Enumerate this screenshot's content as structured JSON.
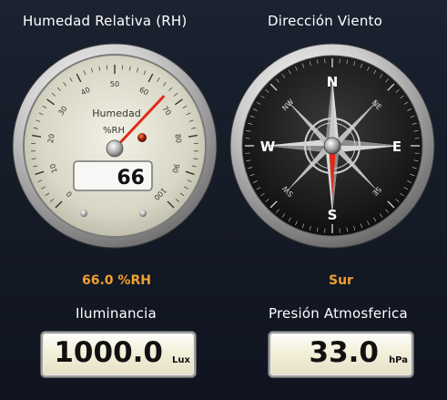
{
  "panels": {
    "humidity": {
      "title": "Humedad Relativa (RH)",
      "gauge_label_1": "Humedad",
      "gauge_label_2": "%RH",
      "display_value": "66",
      "reading": "66.0 %RH",
      "value": 66,
      "scale_min": 0,
      "scale_max": 100,
      "ticks": [
        "0",
        "10",
        "20",
        "30",
        "40",
        "50",
        "60",
        "70",
        "80",
        "90",
        "100"
      ]
    },
    "wind": {
      "title": "Dirección Viento",
      "reading": "Sur",
      "heading_degrees": 180,
      "cardinals": [
        "N",
        "E",
        "S",
        "W"
      ],
      "intercardinals": [
        "NE",
        "SE",
        "SW",
        "NW"
      ]
    },
    "illuminance": {
      "title": "Iluminancia",
      "value": "1000.0",
      "unit": "Lux"
    },
    "pressure": {
      "title": "Presión Atmosferica",
      "value": "33.0",
      "unit": "hPa"
    }
  },
  "colors": {
    "reading_text": "#f0a030",
    "needle": "#e02a1a",
    "background": "#151b27"
  }
}
